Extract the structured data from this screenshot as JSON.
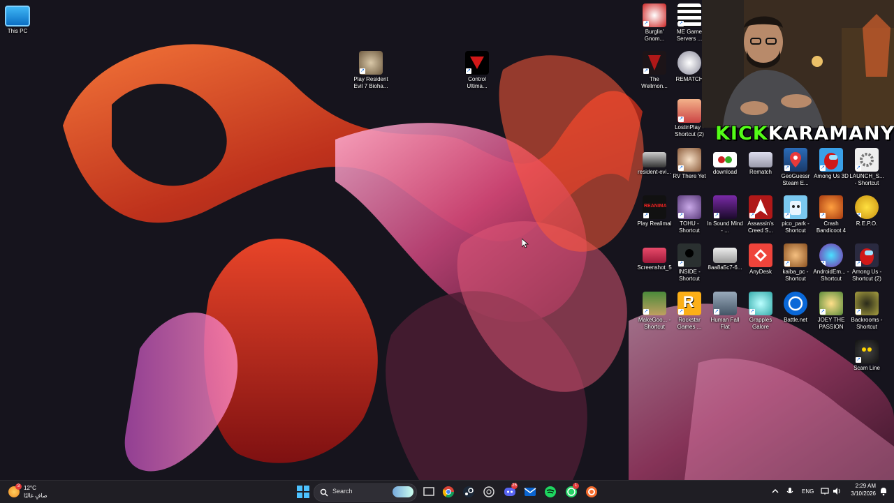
{
  "desktop_icons": {
    "this_pc": "This PC",
    "resident_evil_7": "Play Resident Evil 7 Bioha...",
    "control": "Control Ultima...",
    "burglin_gnomes": "Burglin' Gnom...",
    "me_game_servers": "ME Game Servers ...",
    "wellmon": "The Wellmon...",
    "rematch_top": "REMATCH",
    "lostinplay": "LostinPlay - Shortcut (2)",
    "resident_evil_s": "resident-evi...",
    "rv_there_yet": "RV There Yet",
    "download": "download",
    "rematch": "Rematch",
    "geoguessr": "GeoGuessr Steam E...",
    "among_us_3d": "Among Us 3D",
    "launch_shortcut": "LAUNCH_S... - Shortcut",
    "play_realimal": "Play Realimal",
    "tohu": "TOHU - Shortcut",
    "in_sound_mind": "In Sound Mind - ...",
    "assassins_creed": "Assassin's Creed S...",
    "pico_park": "pico_park - Shortcut",
    "crash_bandicoot": "Crash Bandicoot 4",
    "repo": "R.E.P.O.",
    "screenshot": "Screenshot_5",
    "inside": "INSIDE - Shortcut",
    "hash_file": "8aa8a5c7-6...",
    "anydesk": "AnyDesk",
    "kaiba": "kaiba_pc - Shortcut",
    "androidem": "AndroidEm... - Shortcut",
    "among_us_shortcut": "Among Us - Shortcut (2)",
    "makegood": "MakeGoo... - Shortcut",
    "rockstar": "Rockstar Games ...",
    "human_fall_flat": "Human Fall Flat",
    "grapples_galore": "Grapples Galore",
    "battlenet": "Battle.net",
    "joey_passion": "JOEY THE PASSION",
    "backrooms": "Backrooms - Shortcut",
    "scam_line": "Scam Line"
  },
  "overlay": {
    "brand_kick": "KICK",
    "brand_name": "KARAMANY"
  },
  "taskbar": {
    "weather_temp": "12°C",
    "weather_desc": "صافٍ غالبًا",
    "weather_badge": "3",
    "search_label": "Search",
    "language": "ENG",
    "time": "2:29 AM",
    "date": "3/10/2026",
    "discord_badge": "25",
    "whatsapp_badge": "1"
  }
}
